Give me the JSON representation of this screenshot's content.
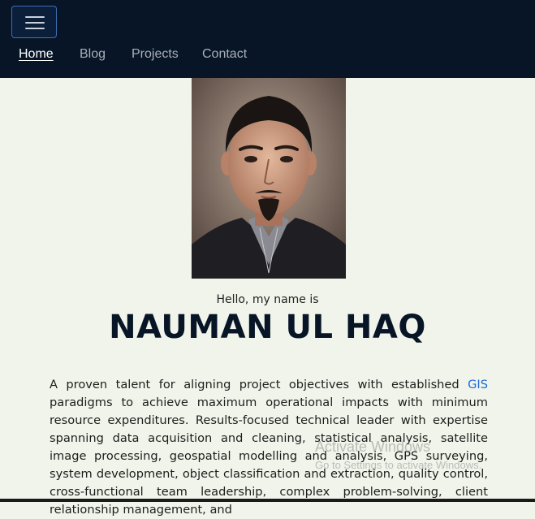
{
  "navbar": {
    "toggle_icon": "hamburger-icon",
    "links": [
      {
        "label": "Home",
        "active": true
      },
      {
        "label": "Blog",
        "active": false
      },
      {
        "label": "Projects",
        "active": false
      },
      {
        "label": "Contact",
        "active": false
      }
    ],
    "bg_color": "#071527"
  },
  "hero": {
    "greeting": "Hello, my name is",
    "name": "NAUMAN UL HAQ",
    "bio_before_link": "A proven talent for aligning project objectives with established ",
    "bio_link": "GIS",
    "bio_after_link": " paradigms to achieve maximum operational impacts with minimum resource expenditures. Results-focused technical leader with expertise spanning data acquisition and cleaning, statistical analysis, satellite image processing, geospatial modelling and analysis, GPS surveying, system development, object classification and extraction, quality control, cross-functional team leadership, complex problem-solving, client relationship management, and"
  },
  "watermark": {
    "title": "Activate Windows",
    "subtitle": "Go to Settings to activate Windows."
  },
  "colors": {
    "page_bg": "#f1f4ea",
    "link": "#1e6bd8",
    "name_text": "#071527"
  }
}
